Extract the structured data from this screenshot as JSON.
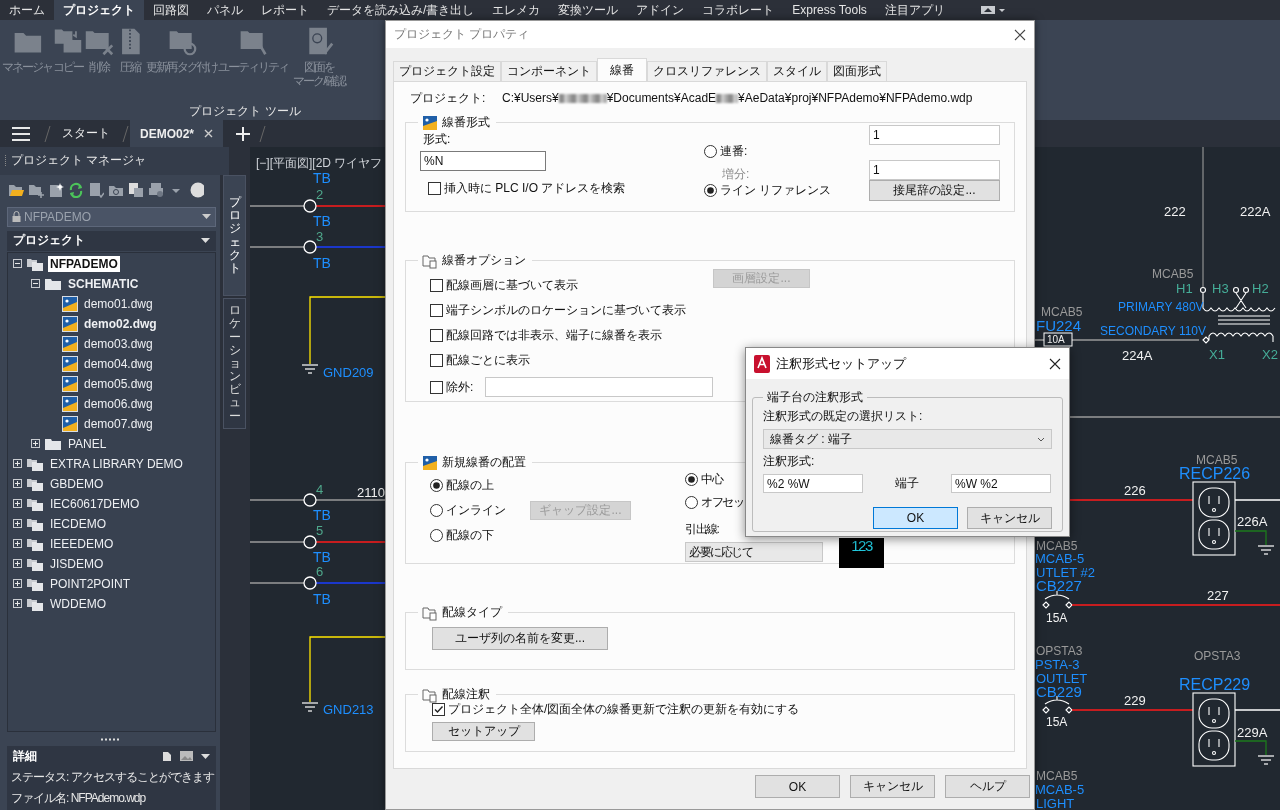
{
  "menu_tabs": [
    {
      "label": "ホーム",
      "selected": false
    },
    {
      "label": "プロジェクト",
      "selected": true
    },
    {
      "label": "回路図",
      "selected": false
    },
    {
      "label": "パネル",
      "selected": false
    },
    {
      "label": "レポート",
      "selected": false
    },
    {
      "label": "データを読み込み/書き出し",
      "selected": false
    },
    {
      "label": "エレメカ",
      "selected": false
    },
    {
      "label": "変換ツール",
      "selected": false
    },
    {
      "label": "アドイン",
      "selected": false
    },
    {
      "label": "コラボレート",
      "selected": false
    },
    {
      "label": "Express Tools",
      "selected": false
    },
    {
      "label": "注目アプリ",
      "selected": false
    }
  ],
  "ribbon": {
    "buttons": [
      {
        "lines": [
          "マネージャ"
        ],
        "disabled": true
      },
      {
        "lines": [
          "コピー"
        ],
        "disabled": true
      },
      {
        "lines": [
          "削除"
        ],
        "disabled": true
      },
      {
        "lines": [
          "圧縮"
        ],
        "disabled": true
      },
      {
        "lines": [
          "更新/再タグ付け"
        ],
        "disabled": true
      },
      {
        "lines": [
          "ユーティリティ"
        ],
        "disabled": true
      },
      {
        "lines": [
          "図面を",
          "マーク/確認"
        ],
        "disabled": true
      }
    ],
    "panel_title": "プロジェクト ツール"
  },
  "doc_tabs": [
    {
      "label": "スタート",
      "selected": false
    },
    {
      "label": "DEMO02*",
      "selected": true
    }
  ],
  "project_manager": {
    "title": "プロジェクト マネージャ",
    "project_select": "NFPADEMO",
    "tree_header": "プロジェクト",
    "tree": [
      {
        "label": "NFPADEMO",
        "kind": "project",
        "selected": true,
        "active": true,
        "expanded": true,
        "children": [
          {
            "label": "SCHEMATIC",
            "kind": "folder",
            "selected": false,
            "active": true,
            "expanded": true,
            "children": [
              {
                "label": "demo01.dwg",
                "kind": "drawing",
                "selected": false,
                "active": false
              },
              {
                "label": "demo02.dwg",
                "kind": "drawing",
                "selected": false,
                "active": true
              },
              {
                "label": "demo03.dwg",
                "kind": "drawing",
                "selected": false,
                "active": false
              },
              {
                "label": "demo04.dwg",
                "kind": "drawing",
                "selected": false,
                "active": false
              },
              {
                "label": "demo05.dwg",
                "kind": "drawing",
                "selected": false,
                "active": false
              },
              {
                "label": "demo06.dwg",
                "kind": "drawing",
                "selected": false,
                "active": false
              },
              {
                "label": "demo07.dwg",
                "kind": "drawing",
                "selected": false,
                "active": false
              }
            ]
          },
          {
            "label": "PANEL",
            "kind": "folder",
            "selected": false,
            "active": false,
            "expanded": false
          }
        ]
      },
      {
        "label": "EXTRA LIBRARY DEMO",
        "kind": "project",
        "selected": false,
        "active": false,
        "expanded": false
      },
      {
        "label": "GBDEMO",
        "kind": "project",
        "selected": false,
        "active": false,
        "expanded": false
      },
      {
        "label": "IEC60617DEMO",
        "kind": "project",
        "selected": false,
        "active": false,
        "expanded": false
      },
      {
        "label": "IECDEMO",
        "kind": "project",
        "selected": false,
        "active": false,
        "expanded": false
      },
      {
        "label": "IEEEDEMO",
        "kind": "project",
        "selected": false,
        "active": false,
        "expanded": false
      },
      {
        "label": "JISDEMO",
        "kind": "project",
        "selected": false,
        "active": false,
        "expanded": false
      },
      {
        "label": "POINT2POINT",
        "kind": "project",
        "selected": false,
        "active": false,
        "expanded": false
      },
      {
        "label": "WDDEMO",
        "kind": "project",
        "selected": false,
        "active": false,
        "expanded": false
      }
    ],
    "details_title": "詳細",
    "details": [
      "ステータス: アクセスすることができます",
      "ファイル名: NFPAdemo.wdp"
    ],
    "side_tabs": [
      {
        "label": "プロジェクト",
        "selected": true
      },
      {
        "label": "ロケーションビュー",
        "selected": false
      }
    ]
  },
  "canvas": {
    "texts": [
      {
        "text": "[−][平面図][2D ワイヤフ",
        "kind": "view"
      },
      {
        "text": "TB",
        "kind": "terminal_tag"
      },
      {
        "text": "2",
        "kind": "terminal_number"
      },
      {
        "text": "TB",
        "kind": "terminal_tag"
      },
      {
        "text": "3",
        "kind": "terminal_number"
      },
      {
        "text": "TB",
        "kind": "terminal_tag"
      },
      {
        "text": "GND209",
        "kind": "device_tag"
      },
      {
        "text": "4",
        "kind": "terminal_number"
      },
      {
        "text": "2110",
        "kind": "wire_number"
      },
      {
        "text": "TB",
        "kind": "terminal_tag"
      },
      {
        "text": "5",
        "kind": "terminal_number"
      },
      {
        "text": "TB",
        "kind": "terminal_tag"
      },
      {
        "text": "6",
        "kind": "terminal_number"
      },
      {
        "text": "TB",
        "kind": "terminal_tag"
      },
      {
        "text": "GND213",
        "kind": "device_tag"
      },
      {
        "text": "222",
        "kind": "wire_number"
      },
      {
        "text": "222A",
        "kind": "wire_number"
      },
      {
        "text": "MCAB5",
        "kind": "location"
      },
      {
        "text": "H1",
        "kind": "pin"
      },
      {
        "text": "H3",
        "kind": "pin"
      },
      {
        "text": "H2",
        "kind": "pin"
      },
      {
        "text": "PRIMARY 480V",
        "kind": "device_tag"
      },
      {
        "text": "SECONDARY 110V",
        "kind": "device_tag"
      },
      {
        "text": "MCAB5",
        "kind": "location"
      },
      {
        "text": "FU224",
        "kind": "device_tag"
      },
      {
        "text": "10A",
        "kind": "rating"
      },
      {
        "text": "224A",
        "kind": "wire_number"
      },
      {
        "text": "X1",
        "kind": "pin"
      },
      {
        "text": "X2",
        "kind": "pin"
      },
      {
        "text": "226",
        "kind": "wire_number"
      },
      {
        "text": "MCAB5",
        "kind": "location"
      },
      {
        "text": "RECP226",
        "kind": "device_tag"
      },
      {
        "text": "226A",
        "kind": "wire_number"
      },
      {
        "text": "MCAB5",
        "kind": "location"
      },
      {
        "text": "MCAB-5",
        "kind": "device_tag"
      },
      {
        "text": "UTLET #2",
        "kind": "device_tag"
      },
      {
        "text": "CB227",
        "kind": "device_tag"
      },
      {
        "text": "15A",
        "kind": "rating"
      },
      {
        "text": "227",
        "kind": "wire_number"
      },
      {
        "text": "OPSTA3",
        "kind": "location"
      },
      {
        "text": "PSTA-3",
        "kind": "device_tag"
      },
      {
        "text": "OUTLET",
        "kind": "device_tag"
      },
      {
        "text": "CB229",
        "kind": "device_tag"
      },
      {
        "text": "15A",
        "kind": "rating"
      },
      {
        "text": "229",
        "kind": "wire_number"
      },
      {
        "text": "OPSTA3",
        "kind": "location"
      },
      {
        "text": "RECP229",
        "kind": "device_tag"
      },
      {
        "text": "229A",
        "kind": "wire_number"
      },
      {
        "text": "MCAB5",
        "kind": "location"
      },
      {
        "text": "MCAB-5",
        "kind": "device_tag"
      },
      {
        "text": "LIGHT",
        "kind": "device_tag"
      }
    ]
  },
  "dialog": {
    "title": "プロジェクト プロパティ",
    "tabs": [
      {
        "label": "プロジェクト設定",
        "selected": false
      },
      {
        "label": "コンポーネント",
        "selected": false
      },
      {
        "label": "線番",
        "selected": true
      },
      {
        "label": "クロスリファレンス",
        "selected": false
      },
      {
        "label": "スタイル",
        "selected": false
      },
      {
        "label": "図面形式",
        "selected": false
      }
    ],
    "project_label": "プロジェクト:",
    "project_path": [
      "C:¥Users¥",
      "¥Documents¥AcadE",
      "¥AeData¥proj¥NFPAdemo¥NFPAdemo.wdp"
    ],
    "format_group": {
      "title": "線番形式",
      "format_label": "形式:",
      "format_value": "%N",
      "plc_check": {
        "label": "挿入時に PLC I/O アドレスを検索",
        "checked": false
      },
      "sequential": {
        "label": "連番:",
        "selected": false,
        "value": "1"
      },
      "increment": {
        "label": "増分:",
        "disabled": true,
        "value": "1"
      },
      "line_reference": {
        "label": "ライン リファレンス",
        "selected": true
      },
      "suffix_button": "接尾辞の設定..."
    },
    "options_group": {
      "title": "線番オプション",
      "layer_button": {
        "label": "画層設定...",
        "disabled": true
      },
      "checks": [
        {
          "label": "配線画層に基づいて表示",
          "checked": false
        },
        {
          "label": "端子シンボルのロケーションに基づいて表示",
          "checked": false
        },
        {
          "label": "配線回路では非表示、端子に線番を表示",
          "checked": false
        },
        {
          "label": "配線ごとに表示",
          "checked": false
        }
      ],
      "exclude": {
        "label": "除外:",
        "checked": false
      }
    },
    "placement_group": {
      "title": "新規線番の配置",
      "positions": [
        {
          "label": "配線の上",
          "selected": true
        },
        {
          "label": "インライン",
          "selected": false
        },
        {
          "label": "配線の下",
          "selected": false
        }
      ],
      "gap_button": {
        "label": "ギャップ設定...",
        "disabled": true
      },
      "alignments": [
        {
          "label": "中心",
          "selected": true
        },
        {
          "label": "オフセッ",
          "selected": false
        }
      ],
      "leader_label": "引出線:",
      "leader_value": "必要に応じて",
      "preview": "123"
    },
    "wire_type_group": {
      "title": "配線タイプ",
      "rename_button": "ユーザ列の名前を変更..."
    },
    "annotation_group": {
      "title": "配線注釈",
      "enable_check": {
        "label": "プロジェクト全体/図面全体の線番更新で注釈の更新を有効にする",
        "checked": true
      },
      "setup_button": "セットアップ"
    },
    "buttons": [
      "OK",
      "キャンセル",
      "ヘルプ"
    ]
  },
  "sub_dialog": {
    "title": "注釈形式セットアップ",
    "group_title": "端子台の注釈形式",
    "list_label": "注釈形式の既定の選択リスト:",
    "list_value": "線番タグ : 端子",
    "format_label": "注釈形式:",
    "format_value": "%2 %W",
    "terminal_label": "端子",
    "terminal_value": "%W %2",
    "buttons": [
      {
        "label": "OK",
        "default": true
      },
      {
        "label": "キャンセル",
        "default": false
      }
    ]
  }
}
